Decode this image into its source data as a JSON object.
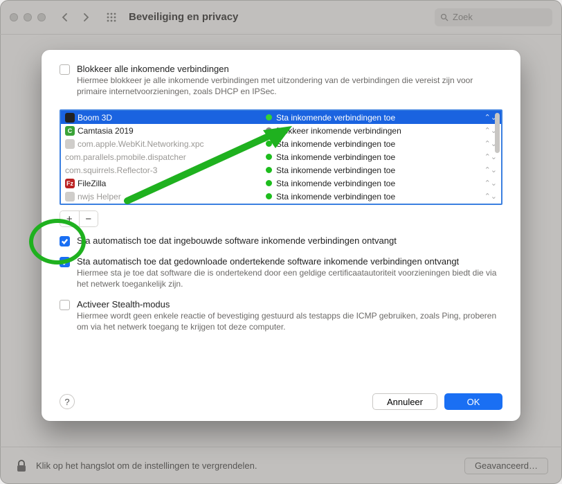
{
  "window": {
    "title": "Beveiliging en privacy",
    "searchPlaceholder": "Zoek",
    "lockText": "Klik op het hangslot om de instellingen te vergrendelen.",
    "advancedLabel": "Geavanceerd…"
  },
  "sheet": {
    "blockAll": {
      "label": "Blokkeer alle inkomende verbindingen",
      "sub": "Hiermee blokkeer je alle inkomende verbindingen met uitzondering van de verbindingen die vereist zijn voor primaire internetvoorzieningen, zoals DHCP en IPSec."
    },
    "apps": [
      {
        "name": "Boom 3D",
        "iconClass": "iconBoom",
        "status": "Sta inkomende verbindingen toe",
        "allow": true,
        "selected": true,
        "dim": false
      },
      {
        "name": "Camtasia 2019",
        "iconClass": "iconCam",
        "letter": "C",
        "status": "Blokkeer inkomende verbindingen",
        "allow": false,
        "selected": false,
        "dim": false
      },
      {
        "name": "com.apple.WebKit.Networking.xpc",
        "iconClass": "iconGen",
        "status": "Sta inkomende verbindingen toe",
        "allow": true,
        "selected": false,
        "dim": true
      },
      {
        "name": "com.parallels.pmobile.dispatcher",
        "iconClass": "",
        "status": "Sta inkomende verbindingen toe",
        "allow": true,
        "selected": false,
        "dim": true
      },
      {
        "name": "com.squirrels.Reflector-3",
        "iconClass": "",
        "status": "Sta inkomende verbindingen toe",
        "allow": true,
        "selected": false,
        "dim": true
      },
      {
        "name": "FileZilla",
        "iconClass": "iconFz",
        "letter": "Fz",
        "status": "Sta inkomende verbindingen toe",
        "allow": true,
        "selected": false,
        "dim": false
      },
      {
        "name": "nwjs Helper",
        "iconClass": "iconGen",
        "status": "Sta inkomende verbindingen toe",
        "allow": true,
        "selected": false,
        "dim": true
      }
    ],
    "autoBuiltin": {
      "label": "Sta automatisch toe dat ingebouwde software inkomende verbindingen ontvangt"
    },
    "autoSigned": {
      "label": "Sta automatisch toe dat gedownloade ondertekende software inkomende verbindingen ontvangt",
      "sub": "Hiermee sta je toe dat software die is ondertekend door een geldige certificaatautoriteit voorzieningen biedt die via het netwerk toegankelijk zijn."
    },
    "stealth": {
      "label": "Activeer Stealth-modus",
      "sub": "Hiermee wordt geen enkele reactie of bevestiging gestuurd als testapps die ICMP gebruiken, zoals Ping, proberen om via het netwerk toegang te krijgen tot deze computer."
    },
    "help": "?",
    "cancel": "Annuleer",
    "ok": "OK",
    "plus": "+",
    "minus": "−"
  }
}
